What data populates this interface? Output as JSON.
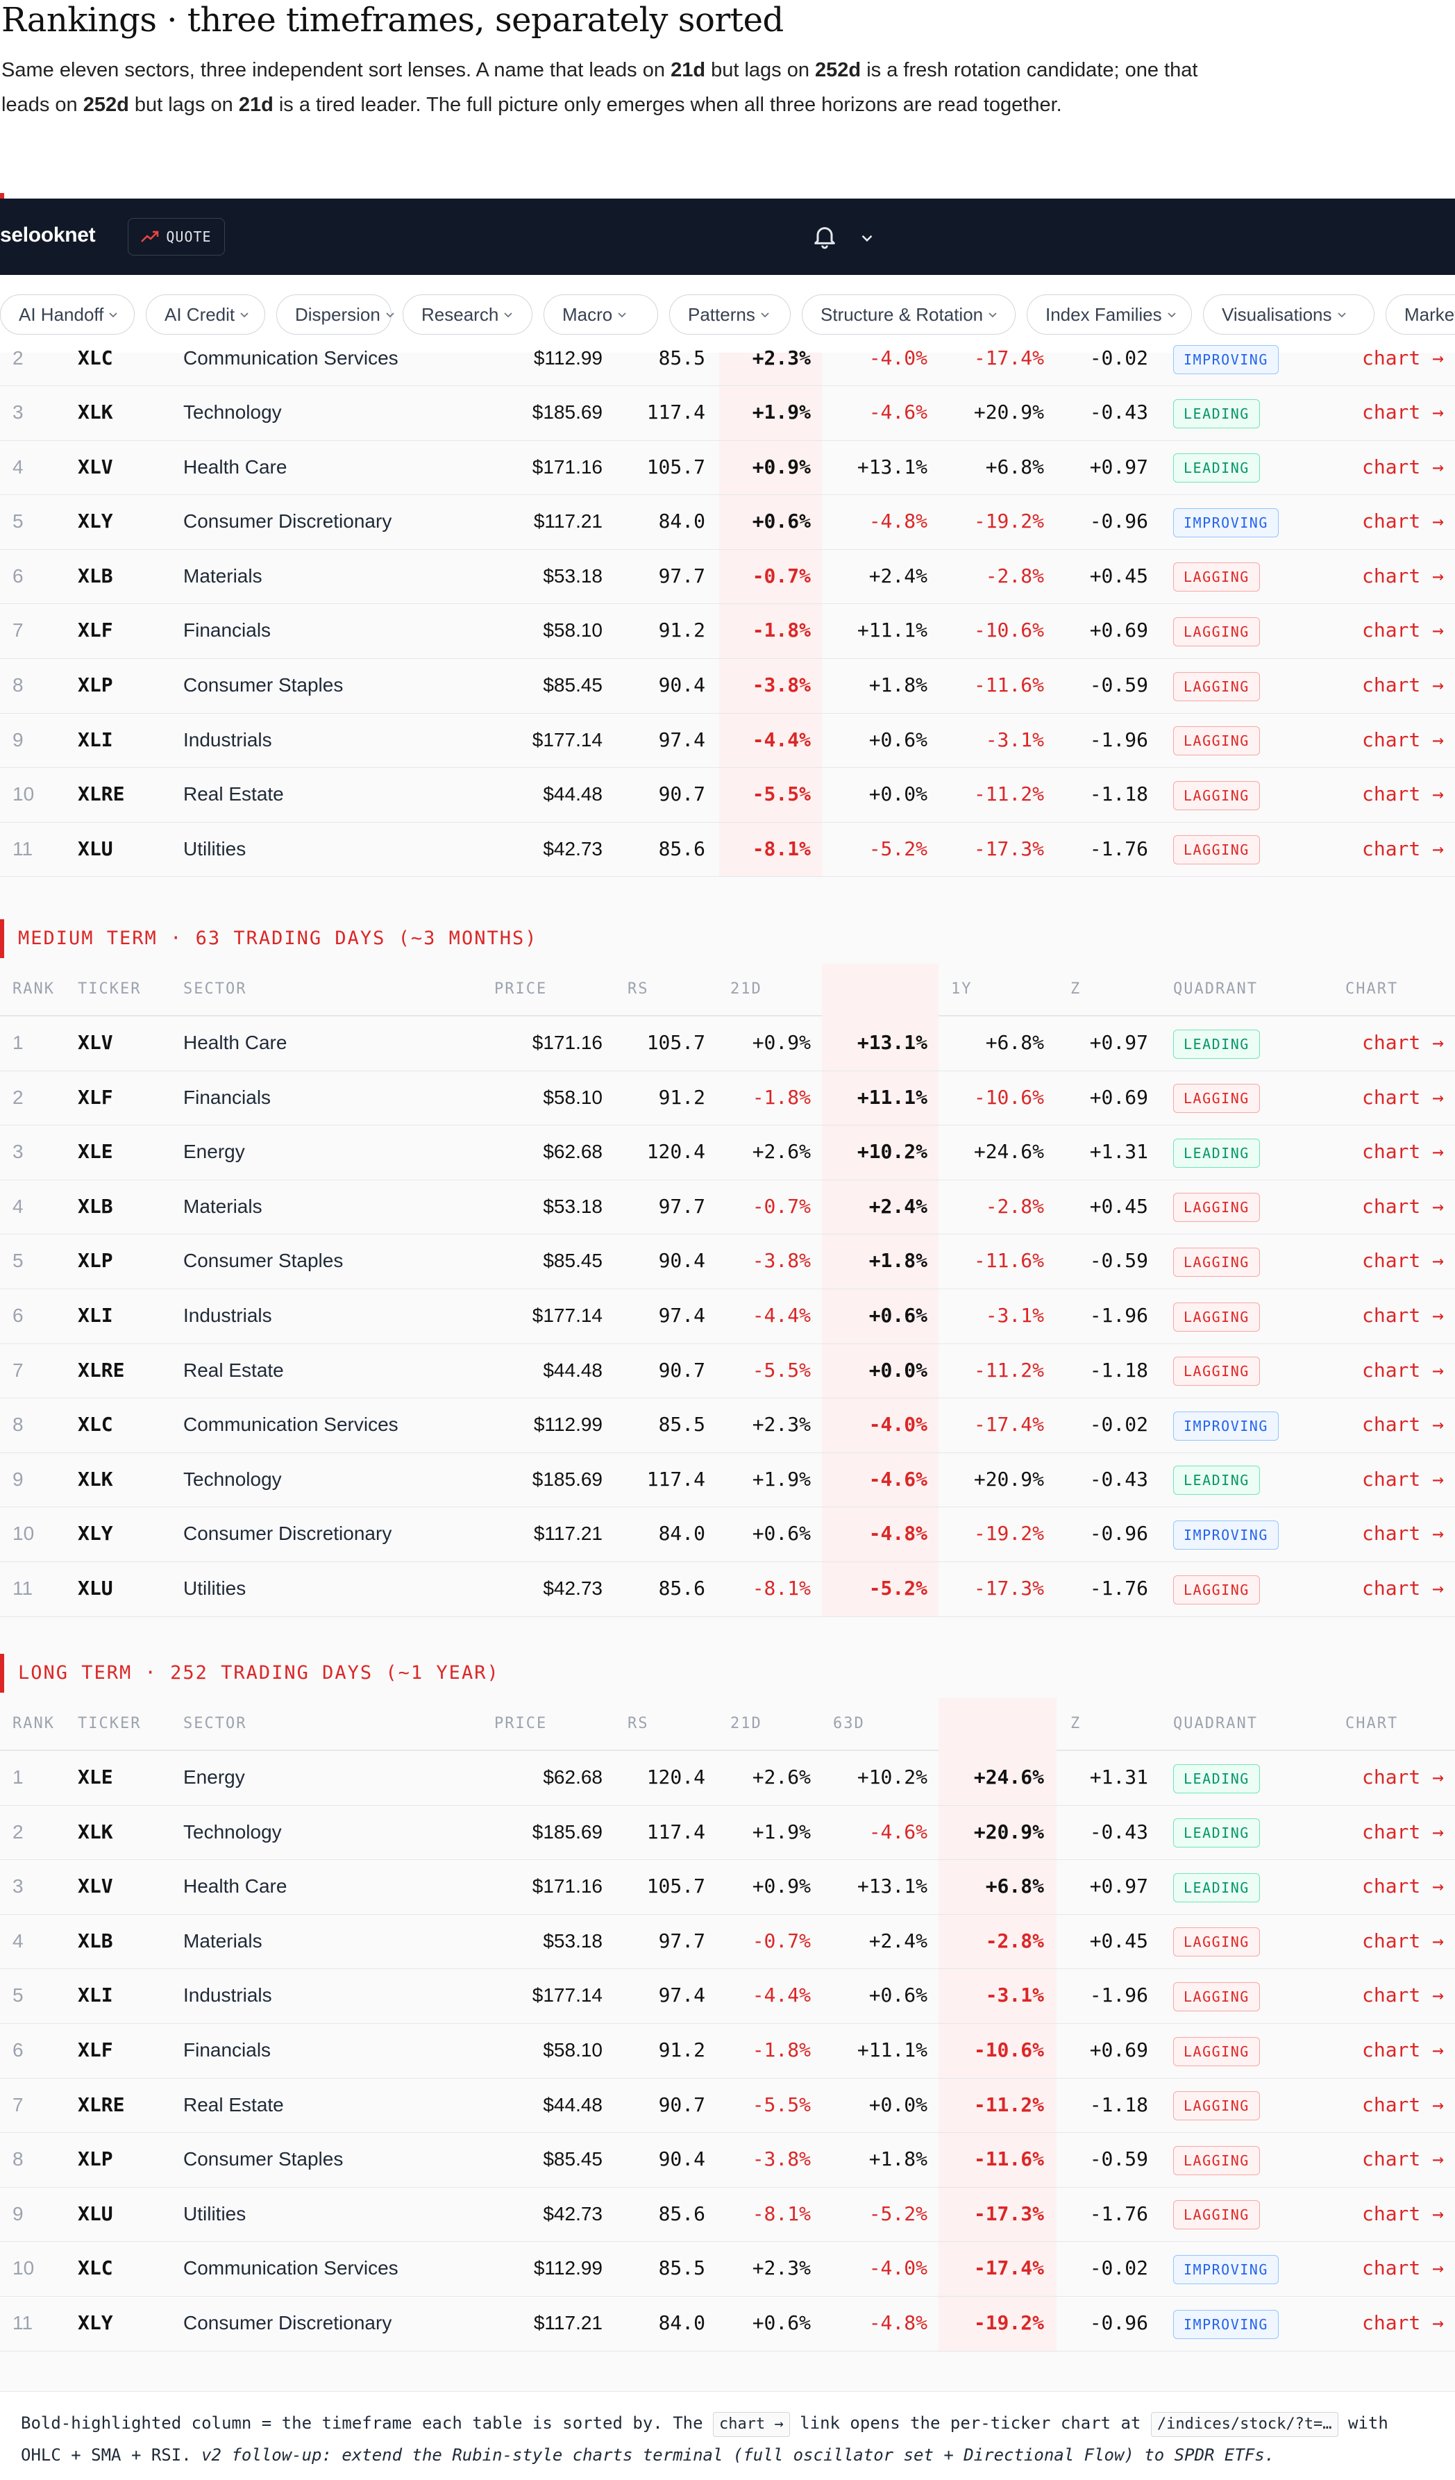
{
  "intro": {
    "title": "Rankings · three timeframes, separately sorted",
    "p1": "Same eleven sectors, three independent sort lenses. A name that leads on ",
    "b1": "21d",
    "p2": " but lags on ",
    "b2": "252d",
    "p3": " is a fresh rotation candidate; one that leads on ",
    "b3": "252d",
    "p4": " but lags on ",
    "b4": "21d",
    "p5": " is a tired leader. The full picture only emerges when all three horizons are read together."
  },
  "nav": {
    "brand": "selooknet",
    "quote": "QUOTE"
  },
  "subnav": [
    "AI Handoff",
    "AI Credit",
    "Dispersion",
    "Research",
    "Macro",
    "Patterns",
    "Structure & Rotation",
    "Index Families",
    "Visualisations",
    "Market"
  ],
  "headers": {
    "rank": "RANK",
    "ticker": "TICKER",
    "sector": "SECTOR",
    "price": "PRICE",
    "rs": "RS",
    "d21": "21D",
    "d63": "63D",
    "y1": "1Y",
    "z": "Z",
    "quadrant": "QUADRANT",
    "chart": "CHART"
  },
  "chart_link": "chart →",
  "sections": [
    {
      "title": "",
      "highlight": "d21",
      "rows": [
        {
          "rank": "2",
          "ticker": "XLC",
          "sector": "Communication Services",
          "price": "$112.99",
          "rs": "85.5",
          "d21": "+2.3%",
          "d63": "-4.0%",
          "y1": "-17.4%",
          "z": "-0.02",
          "quadrant": "IMPROVING"
        },
        {
          "rank": "3",
          "ticker": "XLK",
          "sector": "Technology",
          "price": "$185.69",
          "rs": "117.4",
          "d21": "+1.9%",
          "d63": "-4.6%",
          "y1": "+20.9%",
          "z": "-0.43",
          "quadrant": "LEADING"
        },
        {
          "rank": "4",
          "ticker": "XLV",
          "sector": "Health Care",
          "price": "$171.16",
          "rs": "105.7",
          "d21": "+0.9%",
          "d63": "+13.1%",
          "y1": "+6.8%",
          "z": "+0.97",
          "quadrant": "LEADING"
        },
        {
          "rank": "5",
          "ticker": "XLY",
          "sector": "Consumer Discretionary",
          "price": "$117.21",
          "rs": "84.0",
          "d21": "+0.6%",
          "d63": "-4.8%",
          "y1": "-19.2%",
          "z": "-0.96",
          "quadrant": "IMPROVING"
        },
        {
          "rank": "6",
          "ticker": "XLB",
          "sector": "Materials",
          "price": "$53.18",
          "rs": "97.7",
          "d21": "-0.7%",
          "d63": "+2.4%",
          "y1": "-2.8%",
          "z": "+0.45",
          "quadrant": "LAGGING"
        },
        {
          "rank": "7",
          "ticker": "XLF",
          "sector": "Financials",
          "price": "$58.10",
          "rs": "91.2",
          "d21": "-1.8%",
          "d63": "+11.1%",
          "y1": "-10.6%",
          "z": "+0.69",
          "quadrant": "LAGGING"
        },
        {
          "rank": "8",
          "ticker": "XLP",
          "sector": "Consumer Staples",
          "price": "$85.45",
          "rs": "90.4",
          "d21": "-3.8%",
          "d63": "+1.8%",
          "y1": "-11.6%",
          "z": "-0.59",
          "quadrant": "LAGGING"
        },
        {
          "rank": "9",
          "ticker": "XLI",
          "sector": "Industrials",
          "price": "$177.14",
          "rs": "97.4",
          "d21": "-4.4%",
          "d63": "+0.6%",
          "y1": "-3.1%",
          "z": "-1.96",
          "quadrant": "LAGGING"
        },
        {
          "rank": "10",
          "ticker": "XLRE",
          "sector": "Real Estate",
          "price": "$44.48",
          "rs": "90.7",
          "d21": "-5.5%",
          "d63": "+0.0%",
          "y1": "-11.2%",
          "z": "-1.18",
          "quadrant": "LAGGING"
        },
        {
          "rank": "11",
          "ticker": "XLU",
          "sector": "Utilities",
          "price": "$42.73",
          "rs": "85.6",
          "d21": "-8.1%",
          "d63": "-5.2%",
          "y1": "-17.3%",
          "z": "-1.76",
          "quadrant": "LAGGING"
        }
      ]
    },
    {
      "title": "MEDIUM TERM · 63 TRADING DAYS (~3 MONTHS)",
      "highlight": "d63",
      "rows": [
        {
          "rank": "1",
          "ticker": "XLV",
          "sector": "Health Care",
          "price": "$171.16",
          "rs": "105.7",
          "d21": "+0.9%",
          "d63": "+13.1%",
          "y1": "+6.8%",
          "z": "+0.97",
          "quadrant": "LEADING"
        },
        {
          "rank": "2",
          "ticker": "XLF",
          "sector": "Financials",
          "price": "$58.10",
          "rs": "91.2",
          "d21": "-1.8%",
          "d63": "+11.1%",
          "y1": "-10.6%",
          "z": "+0.69",
          "quadrant": "LAGGING"
        },
        {
          "rank": "3",
          "ticker": "XLE",
          "sector": "Energy",
          "price": "$62.68",
          "rs": "120.4",
          "d21": "+2.6%",
          "d63": "+10.2%",
          "y1": "+24.6%",
          "z": "+1.31",
          "quadrant": "LEADING"
        },
        {
          "rank": "4",
          "ticker": "XLB",
          "sector": "Materials",
          "price": "$53.18",
          "rs": "97.7",
          "d21": "-0.7%",
          "d63": "+2.4%",
          "y1": "-2.8%",
          "z": "+0.45",
          "quadrant": "LAGGING"
        },
        {
          "rank": "5",
          "ticker": "XLP",
          "sector": "Consumer Staples",
          "price": "$85.45",
          "rs": "90.4",
          "d21": "-3.8%",
          "d63": "+1.8%",
          "y1": "-11.6%",
          "z": "-0.59",
          "quadrant": "LAGGING"
        },
        {
          "rank": "6",
          "ticker": "XLI",
          "sector": "Industrials",
          "price": "$177.14",
          "rs": "97.4",
          "d21": "-4.4%",
          "d63": "+0.6%",
          "y1": "-3.1%",
          "z": "-1.96",
          "quadrant": "LAGGING"
        },
        {
          "rank": "7",
          "ticker": "XLRE",
          "sector": "Real Estate",
          "price": "$44.48",
          "rs": "90.7",
          "d21": "-5.5%",
          "d63": "+0.0%",
          "y1": "-11.2%",
          "z": "-1.18",
          "quadrant": "LAGGING"
        },
        {
          "rank": "8",
          "ticker": "XLC",
          "sector": "Communication Services",
          "price": "$112.99",
          "rs": "85.5",
          "d21": "+2.3%",
          "d63": "-4.0%",
          "y1": "-17.4%",
          "z": "-0.02",
          "quadrant": "IMPROVING"
        },
        {
          "rank": "9",
          "ticker": "XLK",
          "sector": "Technology",
          "price": "$185.69",
          "rs": "117.4",
          "d21": "+1.9%",
          "d63": "-4.6%",
          "y1": "+20.9%",
          "z": "-0.43",
          "quadrant": "LEADING"
        },
        {
          "rank": "10",
          "ticker": "XLY",
          "sector": "Consumer Discretionary",
          "price": "$117.21",
          "rs": "84.0",
          "d21": "+0.6%",
          "d63": "-4.8%",
          "y1": "-19.2%",
          "z": "-0.96",
          "quadrant": "IMPROVING"
        },
        {
          "rank": "11",
          "ticker": "XLU",
          "sector": "Utilities",
          "price": "$42.73",
          "rs": "85.6",
          "d21": "-8.1%",
          "d63": "-5.2%",
          "y1": "-17.3%",
          "z": "-1.76",
          "quadrant": "LAGGING"
        }
      ]
    },
    {
      "title": "LONG TERM · 252 TRADING DAYS (~1 YEAR)",
      "highlight": "y1",
      "rows": [
        {
          "rank": "1",
          "ticker": "XLE",
          "sector": "Energy",
          "price": "$62.68",
          "rs": "120.4",
          "d21": "+2.6%",
          "d63": "+10.2%",
          "y1": "+24.6%",
          "z": "+1.31",
          "quadrant": "LEADING"
        },
        {
          "rank": "2",
          "ticker": "XLK",
          "sector": "Technology",
          "price": "$185.69",
          "rs": "117.4",
          "d21": "+1.9%",
          "d63": "-4.6%",
          "y1": "+20.9%",
          "z": "-0.43",
          "quadrant": "LEADING"
        },
        {
          "rank": "3",
          "ticker": "XLV",
          "sector": "Health Care",
          "price": "$171.16",
          "rs": "105.7",
          "d21": "+0.9%",
          "d63": "+13.1%",
          "y1": "+6.8%",
          "z": "+0.97",
          "quadrant": "LEADING"
        },
        {
          "rank": "4",
          "ticker": "XLB",
          "sector": "Materials",
          "price": "$53.18",
          "rs": "97.7",
          "d21": "-0.7%",
          "d63": "+2.4%",
          "y1": "-2.8%",
          "z": "+0.45",
          "quadrant": "LAGGING"
        },
        {
          "rank": "5",
          "ticker": "XLI",
          "sector": "Industrials",
          "price": "$177.14",
          "rs": "97.4",
          "d21": "-4.4%",
          "d63": "+0.6%",
          "y1": "-3.1%",
          "z": "-1.96",
          "quadrant": "LAGGING"
        },
        {
          "rank": "6",
          "ticker": "XLF",
          "sector": "Financials",
          "price": "$58.10",
          "rs": "91.2",
          "d21": "-1.8%",
          "d63": "+11.1%",
          "y1": "-10.6%",
          "z": "+0.69",
          "quadrant": "LAGGING"
        },
        {
          "rank": "7",
          "ticker": "XLRE",
          "sector": "Real Estate",
          "price": "$44.48",
          "rs": "90.7",
          "d21": "-5.5%",
          "d63": "+0.0%",
          "y1": "-11.2%",
          "z": "-1.18",
          "quadrant": "LAGGING"
        },
        {
          "rank": "8",
          "ticker": "XLP",
          "sector": "Consumer Staples",
          "price": "$85.45",
          "rs": "90.4",
          "d21": "-3.8%",
          "d63": "+1.8%",
          "y1": "-11.6%",
          "z": "-0.59",
          "quadrant": "LAGGING"
        },
        {
          "rank": "9",
          "ticker": "XLU",
          "sector": "Utilities",
          "price": "$42.73",
          "rs": "85.6",
          "d21": "-8.1%",
          "d63": "-5.2%",
          "y1": "-17.3%",
          "z": "-1.76",
          "quadrant": "LAGGING"
        },
        {
          "rank": "10",
          "ticker": "XLC",
          "sector": "Communication Services",
          "price": "$112.99",
          "rs": "85.5",
          "d21": "+2.3%",
          "d63": "-4.0%",
          "y1": "-17.4%",
          "z": "-0.02",
          "quadrant": "IMPROVING"
        },
        {
          "rank": "11",
          "ticker": "XLY",
          "sector": "Consumer Discretionary",
          "price": "$117.21",
          "rs": "84.0",
          "d21": "+0.6%",
          "d63": "-4.8%",
          "y1": "-19.2%",
          "z": "-0.96",
          "quadrant": "IMPROVING"
        }
      ]
    }
  ],
  "footnote": {
    "t1": "Bold-highlighted column = the timeframe each table is sorted by. The ",
    "code1": "chart →",
    "t2": " link opens the per-ticker chart at ",
    "code2": "/indices/stock/?t=…",
    "t3": " with OHLC + SMA + RSI. ",
    "italic": "v2 follow-up: extend the Rubin-style charts terminal (full oscillator set + Directional Flow) to SPDR ETFs."
  },
  "colors": {
    "accent": "#dc2626",
    "navbar": "#111827",
    "leading": "#059669",
    "lagging": "#dc2626",
    "improving": "#2563eb"
  }
}
